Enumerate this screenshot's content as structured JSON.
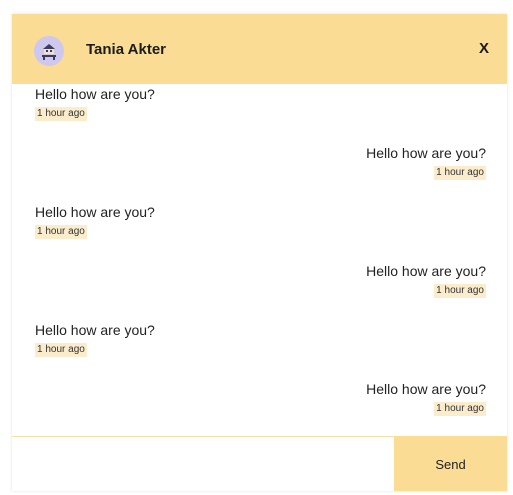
{
  "header": {
    "contact_name": "Tania Akter",
    "avatar_icon": "user-avatar-icon",
    "close_label": "X",
    "background_color": "#fadc95"
  },
  "messages": [
    {
      "side": "received",
      "text": "Hello how are you?",
      "time": "1 hour ago"
    },
    {
      "side": "sent",
      "text": "Hello how are you?",
      "time": "1 hour ago"
    },
    {
      "side": "received",
      "text": "Hello how are you?",
      "time": "1 hour ago"
    },
    {
      "side": "sent",
      "text": "Hello how are you?",
      "time": "1 hour ago"
    },
    {
      "side": "received",
      "text": "Hello how are you?",
      "time": "1 hour ago"
    },
    {
      "side": "sent",
      "text": "Hello how are you?",
      "time": "1 hour ago"
    }
  ],
  "composer": {
    "input_value": "",
    "input_placeholder": "",
    "send_label": "Send"
  }
}
